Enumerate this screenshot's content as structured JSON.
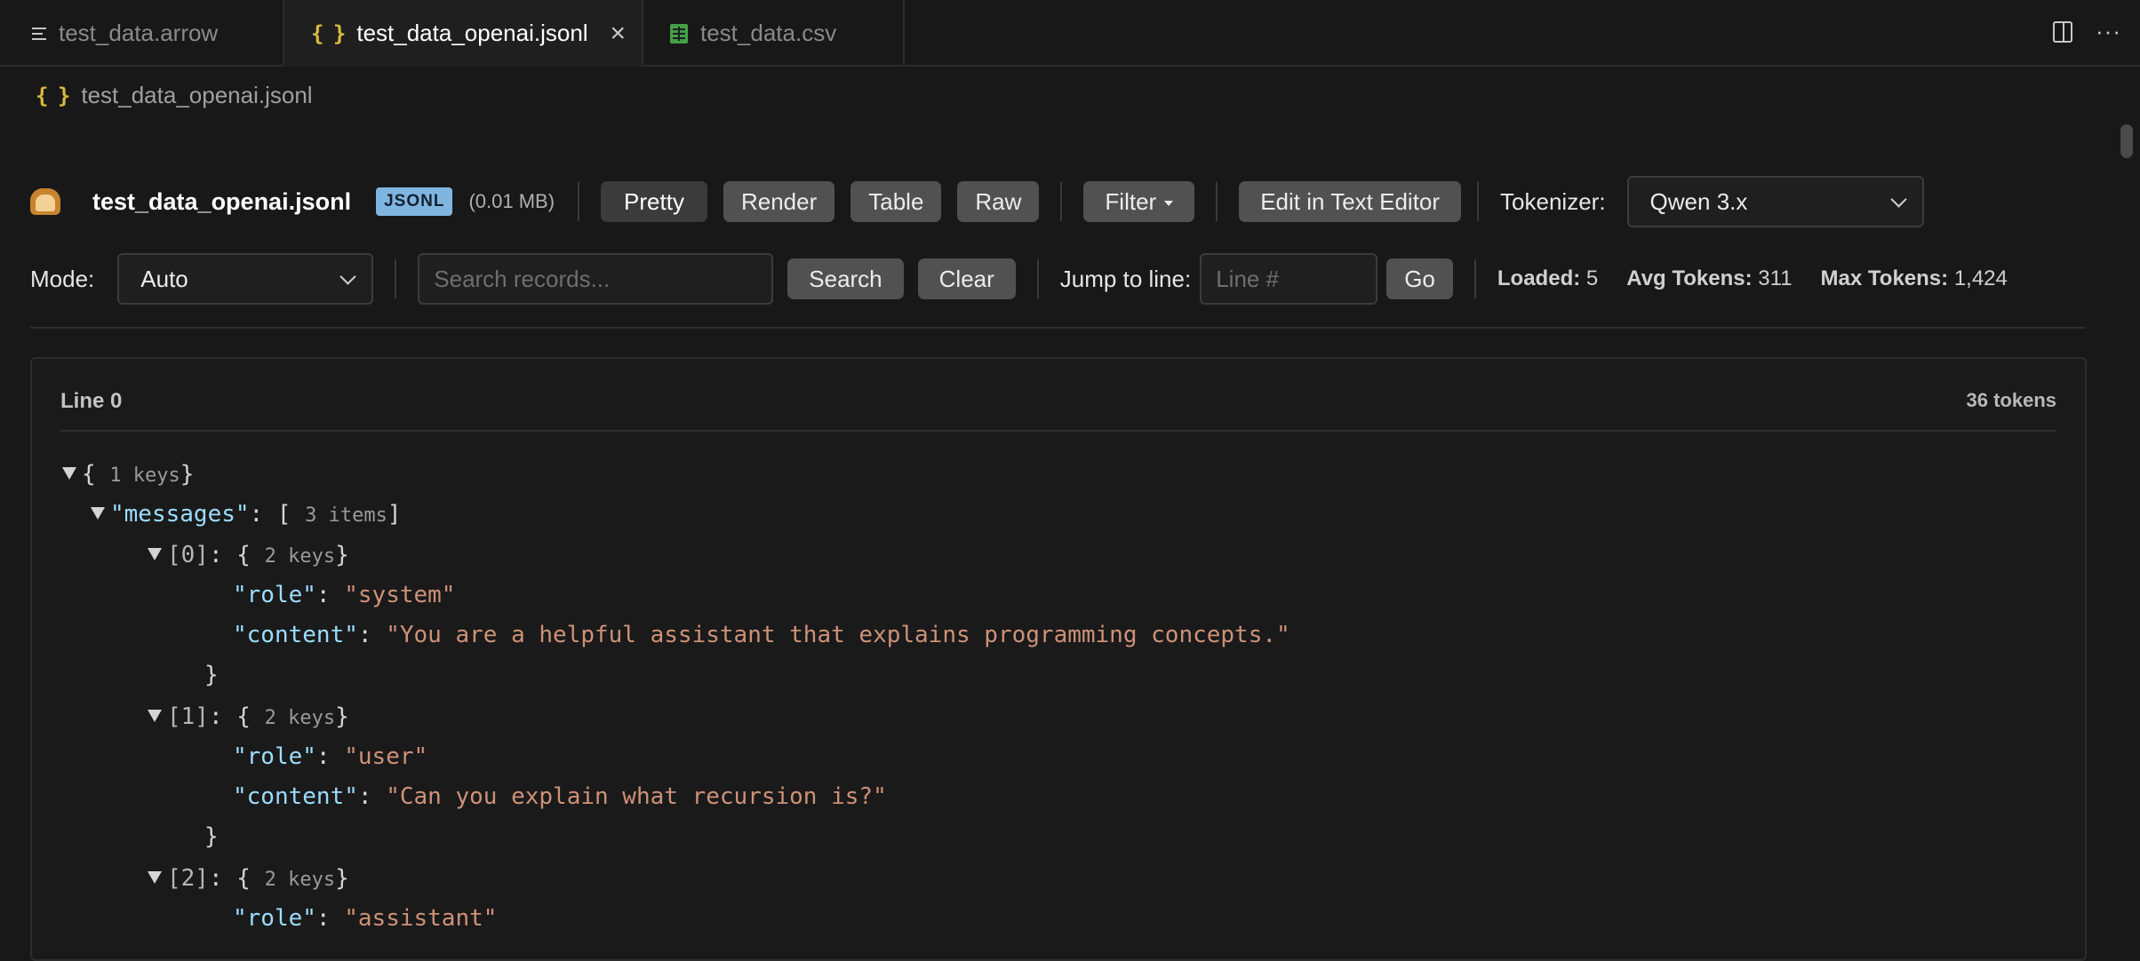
{
  "tabs": [
    {
      "label": "test_data.arrow",
      "icon": "lines-icon",
      "active": false
    },
    {
      "label": "test_data_openai.jsonl",
      "icon": "braces-icon",
      "active": true
    },
    {
      "label": "test_data.csv",
      "icon": "table-icon",
      "active": false
    }
  ],
  "breadcrumb": {
    "label": "test_data_openai.jsonl"
  },
  "toolbar": {
    "file_title": "test_data_openai.jsonl",
    "format_badge": "JSONL",
    "file_size": "(0.01 MB)",
    "view_buttons": [
      "Pretty",
      "Render",
      "Table",
      "Raw"
    ],
    "selected_view": "Pretty",
    "filter_label": "Filter",
    "edit_label": "Edit in Text Editor",
    "tokenizer_label": "Tokenizer:",
    "tokenizer_value": "Qwen 3.x",
    "mode_label": "Mode:",
    "mode_value": "Auto",
    "search_placeholder": "Search records...",
    "search_label": "Search",
    "clear_label": "Clear",
    "jump_label": "Jump to line:",
    "jump_placeholder": "Line #",
    "go_label": "Go",
    "stats": {
      "loaded_label": "Loaded:",
      "loaded_value": "5",
      "avg_label": "Avg Tokens:",
      "avg_value": "311",
      "max_label": "Max Tokens:",
      "max_value": "1,424"
    }
  },
  "record": {
    "line_label": "Line 0",
    "tokens_label": "36 tokens",
    "tree": {
      "root_open": "{",
      "root_meta": "1 keys",
      "root_close": "}",
      "messages_key": "\"messages\"",
      "messages_open": "[",
      "messages_meta": "3 items",
      "messages_close": "]",
      "items": [
        {
          "index": "[0]",
          "meta": "2 keys",
          "role": "\"system\"",
          "content": "\"You are a helpful assistant that explains programming concepts.\""
        },
        {
          "index": "[1]",
          "meta": "2 keys",
          "role": "\"user\"",
          "content": "\"Can you explain what recursion is?\""
        },
        {
          "index": "[2]",
          "meta": "2 keys",
          "role": "\"assistant\""
        }
      ],
      "role_key": "\"role\"",
      "content_key": "\"content\"",
      "colon": ":",
      "obj_open": "{",
      "obj_close": "}"
    }
  }
}
